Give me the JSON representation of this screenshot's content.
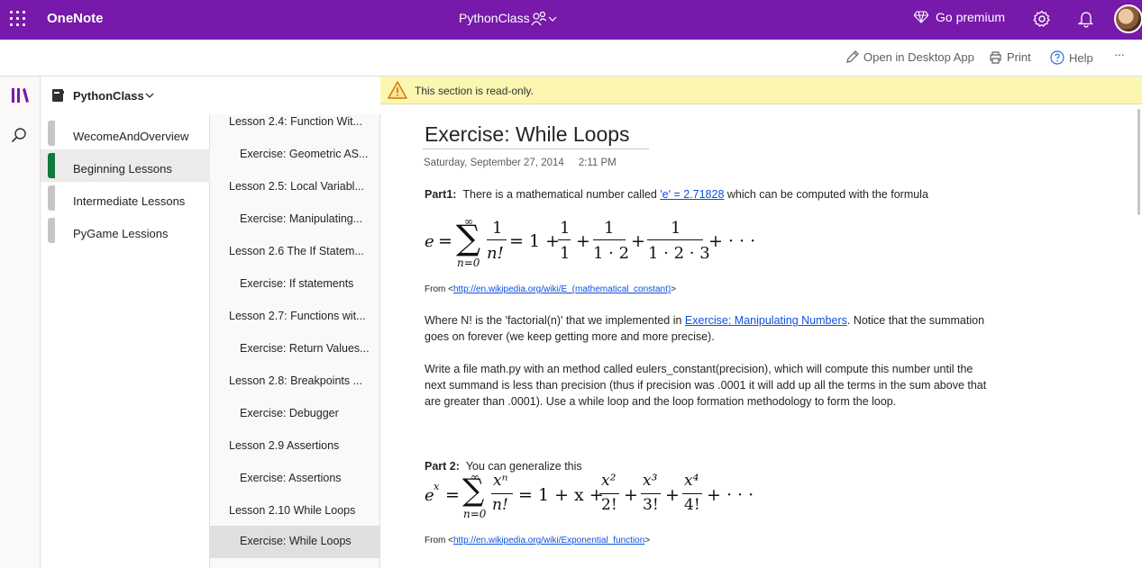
{
  "topbar": {
    "app_name": "OneNote",
    "notebook_title": "PythonClass",
    "premium_label": "Go premium"
  },
  "commands": {
    "open_desktop": "Open in Desktop App",
    "print": "Print",
    "help": "Help",
    "more": "···"
  },
  "notebook": {
    "label": "PythonClass"
  },
  "sections": [
    {
      "label": "WecomeAndOverview",
      "active": false
    },
    {
      "label": "Beginning Lessons",
      "active": true
    },
    {
      "label": "Intermediate Lessons",
      "active": false
    },
    {
      "label": "PyGame Lessions",
      "active": false
    }
  ],
  "pages": [
    {
      "label": "Lesson 2.4: Function Wit...",
      "level": 1
    },
    {
      "label": "Exercise: Geometric AS...",
      "level": 2
    },
    {
      "label": "Lesson 2.5: Local Variabl...",
      "level": 1
    },
    {
      "label": "Exercise: Manipulating...",
      "level": 2
    },
    {
      "label": "Lesson 2.6 The If Statem...",
      "level": 1
    },
    {
      "label": "Exercise: If statements",
      "level": 2
    },
    {
      "label": "Lesson 2.7: Functions wit...",
      "level": 1
    },
    {
      "label": "Exercise: Return Values...",
      "level": 2
    },
    {
      "label": "Lesson 2.8: Breakpoints ...",
      "level": 1
    },
    {
      "label": "Exercise: Debugger",
      "level": 2
    },
    {
      "label": "Lesson 2.9 Assertions",
      "level": 1
    },
    {
      "label": "Exercise: Assertions",
      "level": 2
    },
    {
      "label": "Lesson 2.10 While Loops",
      "level": 1
    },
    {
      "label": "Exercise: While Loops",
      "level": 2,
      "active": true
    }
  ],
  "banner": {
    "text": "This section is read-only."
  },
  "content": {
    "title": "Exercise: While Loops",
    "date": "Saturday, September 27, 2014",
    "time": "2:11 PM",
    "part1": {
      "label": "Part1:",
      "text_before": "There is a mathematical number called ",
      "link": "'e'  = 2.71828",
      "text_after": " which can be computed with the formula"
    },
    "from1": {
      "prefix": "From <",
      "url": "http://en.wikipedia.org/wiki/E_(mathematical_constant)",
      "suffix": ">"
    },
    "para2": {
      "before": "Where N! is the 'factorial(n)' that we implemented in ",
      "link": "Exercise: Manipulating Numbers",
      "after": ".    Notice that the summation goes on forever (we keep getting more and more precise)."
    },
    "para3": "Write a file math.py with an method called eulers_constant(precision), which will compute this number until the next summand is less than precision (thus if precision was .0001 it will add up all the terms in the sum above that are greater than .0001).     Use a while loop and the loop formation methodology to form the loop.",
    "part2": {
      "label": "Part 2:",
      "text": "You can generalize this"
    },
    "from2": {
      "prefix": "From <",
      "url": "http://en.wikipedia.org/wiki/Exponential_function",
      "suffix": ">"
    },
    "formula1": {
      "e": "e",
      "eq": "=",
      "sigma": "∑",
      "inf": "∞",
      "lower": "n=0",
      "n1": "1",
      "d1": "n!",
      "plus_one": "= 1 +",
      "n2": "1",
      "d2": "1",
      "n3": "1",
      "d3": "1 · 2",
      "n4": "1",
      "d4": "1 · 2 · 3",
      "tail": "+ · · ·"
    },
    "formula2": {
      "lhs": "e",
      "sup": "x",
      "eq": "=",
      "sigma": "∑",
      "inf": "∞",
      "lower": "n=0",
      "n1": "xⁿ",
      "d1": "n!",
      "mid": "= 1 + x +",
      "n2": "x²",
      "d2": "2!",
      "n3": "x³",
      "d3": "3!",
      "n4": "x⁴",
      "d4": "4!",
      "tail": "+ · · ·"
    }
  },
  "colors": {
    "brand": "#7719aa",
    "active_section": "#0f7b3b",
    "link": "#0e4fe0",
    "banner": "#fbf6b0"
  }
}
